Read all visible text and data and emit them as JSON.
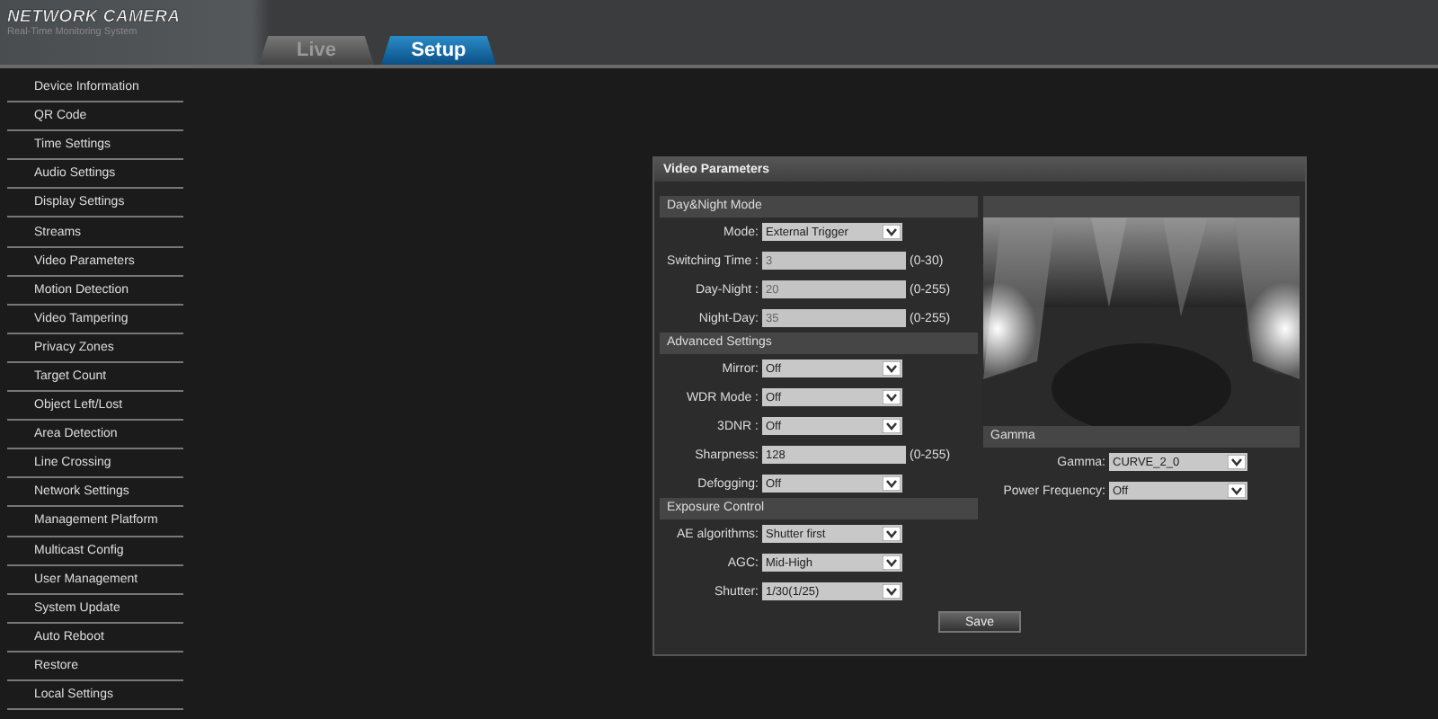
{
  "header": {
    "brand": "NETWORK CAMERA",
    "subtitle": "Real-Time Monitoring System"
  },
  "tabs": [
    {
      "label": "Live",
      "selected": false
    },
    {
      "label": "Setup",
      "selected": true
    }
  ],
  "sidebar": {
    "items": [
      "Device Information",
      "QR Code",
      "Time Settings",
      "Audio Settings",
      "Display Settings",
      "Streams",
      "Video Parameters",
      "Motion Detection",
      "Video Tampering",
      "Privacy Zones",
      "Target Count",
      "Object Left/Lost",
      "Area Detection",
      "Line Crossing",
      "Network Settings",
      "Management Platform",
      "Multicast Config",
      "User Management",
      "System Update",
      "Auto Reboot",
      "Restore",
      "Local Settings"
    ]
  },
  "panel": {
    "title": "Video Parameters",
    "sections": [
      {
        "title": "Day&Night Mode",
        "fields": [
          {
            "kind": "select",
            "label": "Mode:",
            "value": "External Trigger"
          },
          {
            "kind": "input",
            "label": "Switching Time :",
            "value": "3",
            "range": "(0-30)",
            "disabled": true
          },
          {
            "kind": "input",
            "label": "Day-Night :",
            "value": "20",
            "range": "(0-255)",
            "disabled": true
          },
          {
            "kind": "input",
            "label": "Night-Day:",
            "value": "35",
            "range": "(0-255)",
            "disabled": true
          }
        ]
      },
      {
        "title": "Advanced Settings",
        "fields": [
          {
            "kind": "select",
            "label": "Mirror:",
            "value": "Off"
          },
          {
            "kind": "select",
            "label": "WDR Mode :",
            "value": "Off"
          },
          {
            "kind": "select",
            "label": "3DNR :",
            "value": "Off"
          },
          {
            "kind": "input",
            "label": "Sharpness:",
            "value": "128",
            "range": "(0-255)",
            "disabled": false
          },
          {
            "kind": "select",
            "label": "Defogging:",
            "value": "Off"
          }
        ]
      },
      {
        "title": "Exposure Control",
        "fields": [
          {
            "kind": "select",
            "label": "AE algorithms:",
            "value": "Shutter first"
          },
          {
            "kind": "select",
            "label": "AGC:",
            "value": "Mid-High"
          },
          {
            "kind": "select",
            "label": "Shutter:",
            "value": "1/30(1/25)"
          }
        ]
      }
    ],
    "gamma_section": {
      "title": "Gamma",
      "fields": [
        {
          "kind": "select",
          "label": "Gamma:",
          "value": "CURVE_2_0"
        },
        {
          "kind": "select",
          "label": "Power Frequency:",
          "value": "Off"
        }
      ]
    },
    "save_button": "Save"
  }
}
